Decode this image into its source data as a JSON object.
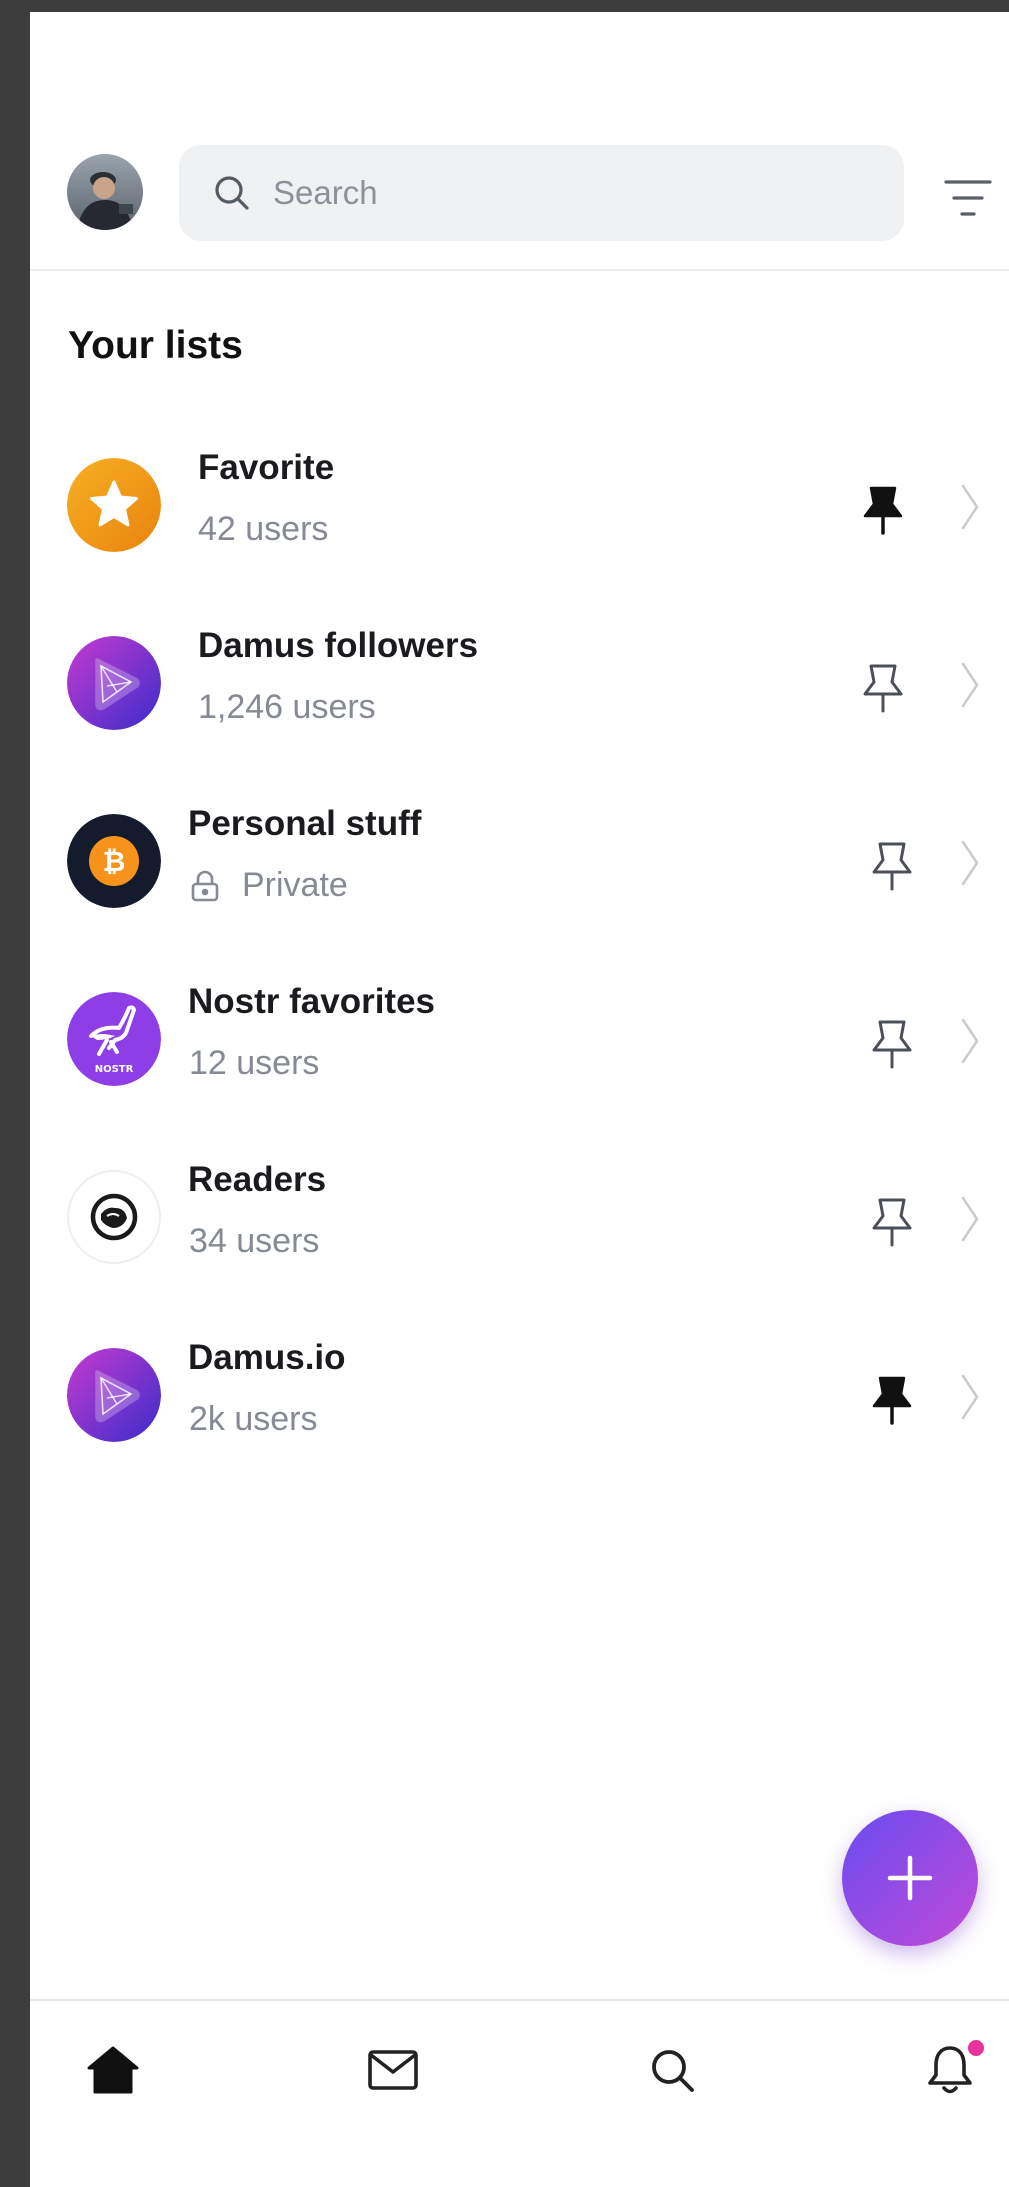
{
  "header": {
    "avatar_name": "profile-avatar",
    "search_placeholder": "Search",
    "search_icon": "search-icon",
    "filter_icon": "filter-icon"
  },
  "section_title": "Your lists",
  "lists": [
    {
      "title": "Favorite",
      "subtitle": "42 users",
      "avatar": "star-icon",
      "pinned": true,
      "private": false
    },
    {
      "title": "Damus followers",
      "subtitle": "1,246 users",
      "avatar": "damus-logo",
      "pinned": false,
      "private": false
    },
    {
      "title": "Personal stuff",
      "subtitle": "Private",
      "avatar": "bitcoin-logo",
      "pinned": false,
      "private": true
    },
    {
      "title": "Nostr favorites",
      "subtitle": "12 users",
      "avatar": "nostr-logo",
      "pinned": false,
      "private": false
    },
    {
      "title": "Readers",
      "subtitle": "34 users",
      "avatar": "readers-logo",
      "pinned": false,
      "private": false
    },
    {
      "title": "Damus.io",
      "subtitle": "2k users",
      "avatar": "damus-logo",
      "pinned": true,
      "private": false
    }
  ],
  "fab": {
    "icon": "plus-icon"
  },
  "bottom_nav": [
    {
      "name": "home",
      "icon": "home-icon",
      "active": true
    },
    {
      "name": "messages",
      "icon": "mail-icon",
      "active": false
    },
    {
      "name": "search",
      "icon": "search-icon",
      "active": false
    },
    {
      "name": "notifications",
      "icon": "bell-icon",
      "active": false,
      "has_badge": true
    }
  ],
  "colors": {
    "accent_start": "#6a4cf0",
    "accent_end": "#c04ad8",
    "favorite_orange": "#f09a1a",
    "subtitle_gray": "#858a94",
    "badge_pink": "#e8339e"
  }
}
